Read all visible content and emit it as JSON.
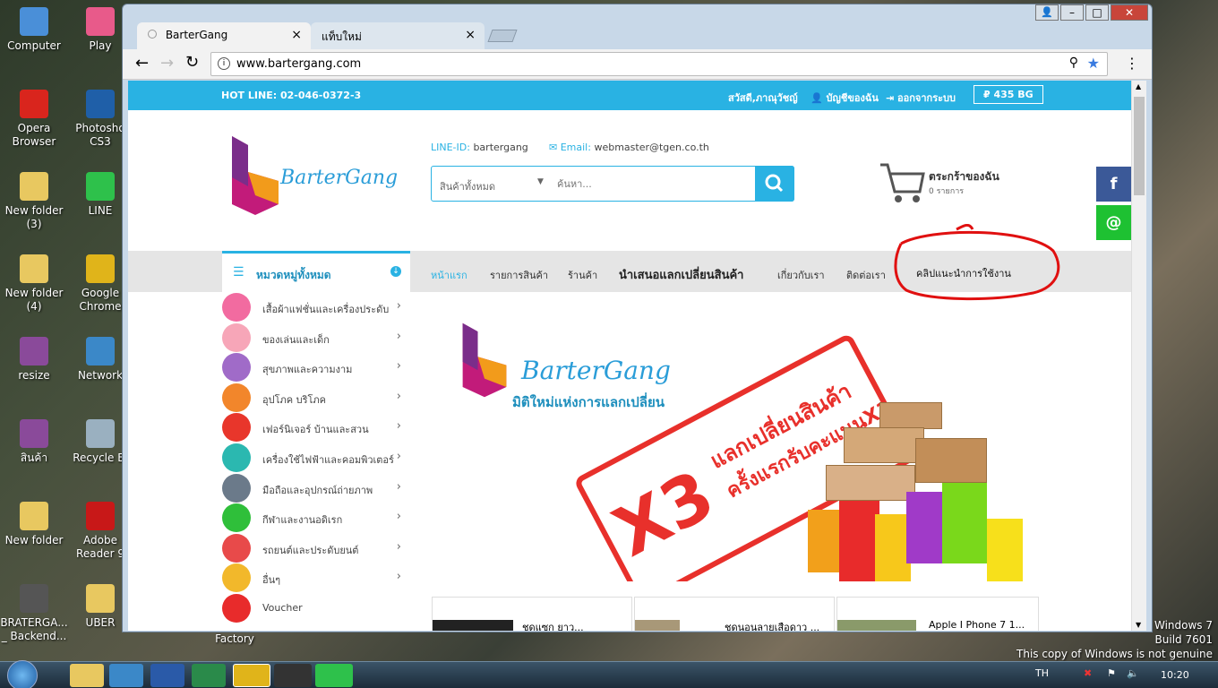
{
  "desktop": {
    "icons": [
      {
        "label": "Computer",
        "color": "#4a8fd8"
      },
      {
        "label": "Play",
        "color": "#e85a8a"
      },
      {
        "label": "Opera Browser",
        "color": "#d9251d"
      },
      {
        "label": "Photosho CS3",
        "color": "#1f5fa8"
      },
      {
        "label": "New folder (3)",
        "color": "#e8c860"
      },
      {
        "label": "LINE",
        "color": "#2ec14b"
      },
      {
        "label": "New folder (4)",
        "color": "#e8c860"
      },
      {
        "label": "Google Chrome",
        "color": "#e0b41a"
      },
      {
        "label": "resize",
        "color": "#8a4a9a"
      },
      {
        "label": "Network",
        "color": "#3b88c8"
      },
      {
        "label": "สินค้า",
        "color": "#8a4a9a"
      },
      {
        "label": "Recycle Bi",
        "color": "#9ab0c0"
      },
      {
        "label": "New folder",
        "color": "#e8c860"
      },
      {
        "label": "Adobe Reader 9",
        "color": "#c81818"
      },
      {
        "label": "BRATERGA... _ Backend...",
        "color": "#555"
      },
      {
        "label": "UBER",
        "color": "#e8c860"
      },
      {
        "label": "Factory",
        "color": ""
      }
    ],
    "watermark": {
      "line1": "Windows 7",
      "line2": "Build 7601",
      "line3": "This copy of Windows is not genuine"
    }
  },
  "taskbar": {
    "lang": "TH",
    "clock": "10:20"
  },
  "browser": {
    "tabs": [
      {
        "title": "BarterGang",
        "close": "×"
      },
      {
        "title": "แท็บใหม่",
        "close": "×"
      }
    ],
    "url": "www.bartergang.com",
    "window_controls": {
      "minimize": "–",
      "maximize": "□",
      "close": "✕"
    }
  },
  "site": {
    "hotline": "HOT LINE: 02-046-0372-3",
    "greeting": "สวัสดี,ภาณุวัชญ์",
    "account": "บัญชีของฉัน",
    "logout": "ออกจากระบบ",
    "balance": "₽ 435 BG",
    "logo_text": "BarterGang",
    "line_id_label": "LINE-ID:",
    "line_id": "bartergang",
    "email_label": "Email:",
    "email": "webmaster@tgen.co.th",
    "search": {
      "category": "สินค้าทั้งหมด",
      "placeholder": "ค้นหา..."
    },
    "cart": {
      "title": "ตระกร้าของฉัน",
      "count": "0 รายการ"
    },
    "social": {
      "facebook": "f",
      "line": "@"
    },
    "categories_header": "หมวดหมู่ทั้งหมด",
    "nav": [
      "หน้าแรก",
      "รายการสินค้า",
      "ร้านค้า",
      "นำเสนอแลกเปลี่ยนสินค้า",
      "เกี่ยวกับเรา",
      "ติดต่อเรา",
      "คลิปแนะนำการใช้งาน"
    ],
    "categories": [
      {
        "label": "เสื้อผ้าแฟชั่นและเครื่องประดับ",
        "color": "#f26ba0"
      },
      {
        "label": "ของเล่นและเด็ก",
        "color": "#f7a6b8"
      },
      {
        "label": "สุขภาพและความงาม",
        "color": "#a06bc8"
      },
      {
        "label": "อุปโภค บริโภค",
        "color": "#f2862b"
      },
      {
        "label": "เฟอร์นิเจอร์ บ้านและสวน",
        "color": "#e8362b"
      },
      {
        "label": "เครื่องใช้ไฟฟ้าและคอมพิวเตอร์",
        "color": "#2bb8b0"
      },
      {
        "label": "มือถือและอุปกรณ์ถ่ายภาพ",
        "color": "#6b7a8a"
      },
      {
        "label": "กีฬาและงานอดิเรก",
        "color": "#2fbf3a"
      },
      {
        "label": "รถยนต์และประดับยนต์",
        "color": "#e84a4a"
      },
      {
        "label": "อื่นๆ",
        "color": "#f2b82b"
      },
      {
        "label": "Voucher",
        "color": "#e82b2b"
      }
    ],
    "banner": {
      "logo": "BarterGang",
      "tagline": "มิติใหม่แห่งการแลกเปลี่ยน",
      "stamp_big": "X3",
      "stamp_line1": "แลกเปลี่ยนสินค้า",
      "stamp_line2": "ครั้งแรกรับคะแนนX3"
    },
    "products": [
      "ชุดแซก ยาว...",
      "ชุดนอนลายเสือดาว ...",
      "Apple I Phone 7 1..."
    ]
  }
}
